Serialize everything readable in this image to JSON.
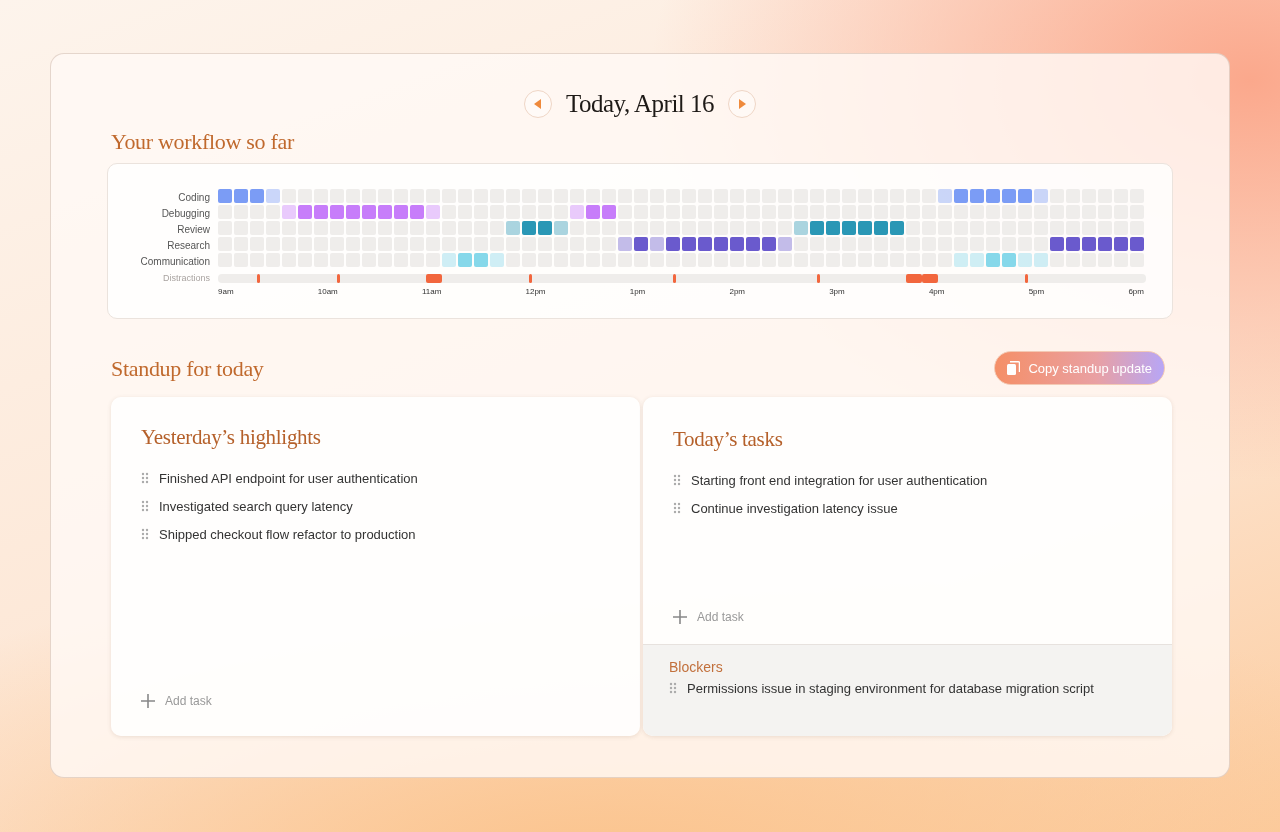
{
  "date_nav": {
    "title": "Today, April 16"
  },
  "workflow": {
    "title": "Your workflow so far",
    "rows": [
      {
        "label": "Coding",
        "color": "#7b9cf5",
        "cells": [
          {
            "kind": "full"
          },
          {
            "kind": "full"
          },
          {
            "kind": "full"
          },
          {
            "kind": "light"
          },
          {
            "kind": "empty"
          },
          {
            "kind": "empty"
          },
          {
            "kind": "empty"
          },
          {
            "kind": "empty"
          },
          {
            "kind": "empty"
          },
          {
            "kind": "empty"
          },
          {
            "kind": "empty"
          },
          {
            "kind": "empty"
          },
          {
            "kind": "empty"
          },
          {
            "kind": "empty"
          },
          {
            "kind": "empty"
          },
          {
            "kind": "empty"
          },
          {
            "kind": "empty"
          },
          {
            "kind": "empty"
          },
          {
            "kind": "empty"
          },
          {
            "kind": "empty"
          },
          {
            "kind": "empty"
          },
          {
            "kind": "empty"
          },
          {
            "kind": "empty"
          },
          {
            "kind": "empty"
          },
          {
            "kind": "empty"
          },
          {
            "kind": "empty"
          },
          {
            "kind": "empty"
          },
          {
            "kind": "empty"
          },
          {
            "kind": "empty"
          },
          {
            "kind": "empty"
          },
          {
            "kind": "empty"
          },
          {
            "kind": "empty"
          },
          {
            "kind": "empty"
          },
          {
            "kind": "empty"
          },
          {
            "kind": "empty"
          },
          {
            "kind": "empty"
          },
          {
            "kind": "empty"
          },
          {
            "kind": "empty"
          },
          {
            "kind": "empty"
          },
          {
            "kind": "empty"
          },
          {
            "kind": "empty"
          },
          {
            "kind": "empty"
          },
          {
            "kind": "empty"
          },
          {
            "kind": "empty"
          },
          {
            "kind": "empty"
          },
          {
            "kind": "light"
          },
          {
            "kind": "full"
          },
          {
            "kind": "full"
          },
          {
            "kind": "full"
          },
          {
            "kind": "full"
          },
          {
            "kind": "full"
          },
          {
            "kind": "light"
          },
          {
            "kind": "empty"
          },
          {
            "kind": "empty"
          },
          {
            "kind": "empty"
          },
          {
            "kind": "empty"
          },
          {
            "kind": "empty"
          },
          {
            "kind": "empty"
          }
        ]
      },
      {
        "label": "Debugging",
        "color": "#c77dfa",
        "cells": [
          {
            "kind": "empty"
          },
          {
            "kind": "empty"
          },
          {
            "kind": "empty"
          },
          {
            "kind": "empty"
          },
          {
            "kind": "light"
          },
          {
            "kind": "full"
          },
          {
            "kind": "full"
          },
          {
            "kind": "full"
          },
          {
            "kind": "full"
          },
          {
            "kind": "full"
          },
          {
            "kind": "full"
          },
          {
            "kind": "full"
          },
          {
            "kind": "full"
          },
          {
            "kind": "light"
          },
          {
            "kind": "empty"
          },
          {
            "kind": "empty"
          },
          {
            "kind": "empty"
          },
          {
            "kind": "empty"
          },
          {
            "kind": "empty"
          },
          {
            "kind": "empty"
          },
          {
            "kind": "empty"
          },
          {
            "kind": "empty"
          },
          {
            "kind": "light"
          },
          {
            "kind": "full"
          },
          {
            "kind": "full"
          },
          {
            "kind": "empty"
          },
          {
            "kind": "empty"
          },
          {
            "kind": "empty"
          },
          {
            "kind": "empty"
          },
          {
            "kind": "empty"
          },
          {
            "kind": "empty"
          },
          {
            "kind": "empty"
          },
          {
            "kind": "empty"
          },
          {
            "kind": "empty"
          },
          {
            "kind": "empty"
          },
          {
            "kind": "empty"
          },
          {
            "kind": "empty"
          },
          {
            "kind": "empty"
          },
          {
            "kind": "empty"
          },
          {
            "kind": "empty"
          },
          {
            "kind": "empty"
          },
          {
            "kind": "empty"
          },
          {
            "kind": "empty"
          },
          {
            "kind": "empty"
          },
          {
            "kind": "empty"
          },
          {
            "kind": "empty"
          },
          {
            "kind": "empty"
          },
          {
            "kind": "empty"
          },
          {
            "kind": "empty"
          },
          {
            "kind": "empty"
          },
          {
            "kind": "empty"
          },
          {
            "kind": "empty"
          },
          {
            "kind": "empty"
          },
          {
            "kind": "empty"
          },
          {
            "kind": "empty"
          },
          {
            "kind": "empty"
          },
          {
            "kind": "empty"
          },
          {
            "kind": "empty"
          }
        ]
      },
      {
        "label": "Review",
        "color": "#2a97b5",
        "cells": [
          {
            "kind": "empty"
          },
          {
            "kind": "empty"
          },
          {
            "kind": "empty"
          },
          {
            "kind": "empty"
          },
          {
            "kind": "empty"
          },
          {
            "kind": "empty"
          },
          {
            "kind": "empty"
          },
          {
            "kind": "empty"
          },
          {
            "kind": "empty"
          },
          {
            "kind": "empty"
          },
          {
            "kind": "empty"
          },
          {
            "kind": "empty"
          },
          {
            "kind": "empty"
          },
          {
            "kind": "empty"
          },
          {
            "kind": "empty"
          },
          {
            "kind": "empty"
          },
          {
            "kind": "empty"
          },
          {
            "kind": "empty"
          },
          {
            "kind": "light"
          },
          {
            "kind": "full"
          },
          {
            "kind": "full"
          },
          {
            "kind": "light"
          },
          {
            "kind": "empty"
          },
          {
            "kind": "empty"
          },
          {
            "kind": "empty"
          },
          {
            "kind": "empty"
          },
          {
            "kind": "empty"
          },
          {
            "kind": "empty"
          },
          {
            "kind": "empty"
          },
          {
            "kind": "empty"
          },
          {
            "kind": "empty"
          },
          {
            "kind": "empty"
          },
          {
            "kind": "empty"
          },
          {
            "kind": "empty"
          },
          {
            "kind": "empty"
          },
          {
            "kind": "empty"
          },
          {
            "kind": "light"
          },
          {
            "kind": "full"
          },
          {
            "kind": "full"
          },
          {
            "kind": "full"
          },
          {
            "kind": "full"
          },
          {
            "kind": "full"
          },
          {
            "kind": "full"
          },
          {
            "kind": "empty"
          },
          {
            "kind": "empty"
          },
          {
            "kind": "empty"
          },
          {
            "kind": "empty"
          },
          {
            "kind": "empty"
          },
          {
            "kind": "empty"
          },
          {
            "kind": "empty"
          },
          {
            "kind": "empty"
          },
          {
            "kind": "empty"
          },
          {
            "kind": "empty"
          },
          {
            "kind": "empty"
          },
          {
            "kind": "empty"
          },
          {
            "kind": "empty"
          },
          {
            "kind": "empty"
          },
          {
            "kind": "empty"
          }
        ]
      },
      {
        "label": "Research",
        "color": "#6a5acd",
        "cells": [
          {
            "kind": "empty"
          },
          {
            "kind": "empty"
          },
          {
            "kind": "empty"
          },
          {
            "kind": "empty"
          },
          {
            "kind": "empty"
          },
          {
            "kind": "empty"
          },
          {
            "kind": "empty"
          },
          {
            "kind": "empty"
          },
          {
            "kind": "empty"
          },
          {
            "kind": "empty"
          },
          {
            "kind": "empty"
          },
          {
            "kind": "empty"
          },
          {
            "kind": "empty"
          },
          {
            "kind": "empty"
          },
          {
            "kind": "empty"
          },
          {
            "kind": "empty"
          },
          {
            "kind": "empty"
          },
          {
            "kind": "empty"
          },
          {
            "kind": "empty"
          },
          {
            "kind": "empty"
          },
          {
            "kind": "empty"
          },
          {
            "kind": "empty"
          },
          {
            "kind": "empty"
          },
          {
            "kind": "empty"
          },
          {
            "kind": "empty"
          },
          {
            "kind": "light"
          },
          {
            "kind": "full"
          },
          {
            "kind": "light"
          },
          {
            "kind": "full"
          },
          {
            "kind": "full"
          },
          {
            "kind": "full"
          },
          {
            "kind": "full"
          },
          {
            "kind": "full"
          },
          {
            "kind": "full"
          },
          {
            "kind": "full"
          },
          {
            "kind": "light"
          },
          {
            "kind": "empty"
          },
          {
            "kind": "empty"
          },
          {
            "kind": "empty"
          },
          {
            "kind": "empty"
          },
          {
            "kind": "empty"
          },
          {
            "kind": "empty"
          },
          {
            "kind": "empty"
          },
          {
            "kind": "empty"
          },
          {
            "kind": "empty"
          },
          {
            "kind": "empty"
          },
          {
            "kind": "empty"
          },
          {
            "kind": "empty"
          },
          {
            "kind": "empty"
          },
          {
            "kind": "empty"
          },
          {
            "kind": "empty"
          },
          {
            "kind": "empty"
          },
          {
            "kind": "full"
          },
          {
            "kind": "full"
          },
          {
            "kind": "full"
          },
          {
            "kind": "full"
          },
          {
            "kind": "full"
          },
          {
            "kind": "full"
          }
        ]
      },
      {
        "label": "Communication",
        "color": "#86d8ea",
        "cells": [
          {
            "kind": "empty"
          },
          {
            "kind": "empty"
          },
          {
            "kind": "empty"
          },
          {
            "kind": "empty"
          },
          {
            "kind": "empty"
          },
          {
            "kind": "empty"
          },
          {
            "kind": "empty"
          },
          {
            "kind": "empty"
          },
          {
            "kind": "empty"
          },
          {
            "kind": "empty"
          },
          {
            "kind": "empty"
          },
          {
            "kind": "empty"
          },
          {
            "kind": "empty"
          },
          {
            "kind": "empty"
          },
          {
            "kind": "light"
          },
          {
            "kind": "full"
          },
          {
            "kind": "full"
          },
          {
            "kind": "light"
          },
          {
            "kind": "empty"
          },
          {
            "kind": "empty"
          },
          {
            "kind": "empty"
          },
          {
            "kind": "empty"
          },
          {
            "kind": "empty"
          },
          {
            "kind": "empty"
          },
          {
            "kind": "empty"
          },
          {
            "kind": "empty"
          },
          {
            "kind": "empty"
          },
          {
            "kind": "empty"
          },
          {
            "kind": "empty"
          },
          {
            "kind": "empty"
          },
          {
            "kind": "empty"
          },
          {
            "kind": "empty"
          },
          {
            "kind": "empty"
          },
          {
            "kind": "empty"
          },
          {
            "kind": "empty"
          },
          {
            "kind": "empty"
          },
          {
            "kind": "empty"
          },
          {
            "kind": "empty"
          },
          {
            "kind": "empty"
          },
          {
            "kind": "empty"
          },
          {
            "kind": "empty"
          },
          {
            "kind": "empty"
          },
          {
            "kind": "empty"
          },
          {
            "kind": "empty"
          },
          {
            "kind": "empty"
          },
          {
            "kind": "empty"
          },
          {
            "kind": "light"
          },
          {
            "kind": "light"
          },
          {
            "kind": "full"
          },
          {
            "kind": "full"
          },
          {
            "kind": "light"
          },
          {
            "kind": "light"
          },
          {
            "kind": "empty"
          },
          {
            "kind": "empty"
          },
          {
            "kind": "empty"
          },
          {
            "kind": "empty"
          },
          {
            "kind": "empty"
          },
          {
            "kind": "empty"
          }
        ]
      }
    ],
    "distractions": {
      "label": "Distractions",
      "slots": [
        {
          "kind": "none"
        },
        {
          "kind": "none"
        },
        {
          "kind": "blip"
        },
        {
          "kind": "none"
        },
        {
          "kind": "none"
        },
        {
          "kind": "none"
        },
        {
          "kind": "none"
        },
        {
          "kind": "blip"
        },
        {
          "kind": "none"
        },
        {
          "kind": "none"
        },
        {
          "kind": "none"
        },
        {
          "kind": "none"
        },
        {
          "kind": "none"
        },
        {
          "kind": "block"
        },
        {
          "kind": "none"
        },
        {
          "kind": "none"
        },
        {
          "kind": "none"
        },
        {
          "kind": "none"
        },
        {
          "kind": "none"
        },
        {
          "kind": "blip"
        },
        {
          "kind": "none"
        },
        {
          "kind": "none"
        },
        {
          "kind": "none"
        },
        {
          "kind": "none"
        },
        {
          "kind": "none"
        },
        {
          "kind": "none"
        },
        {
          "kind": "none"
        },
        {
          "kind": "none"
        },
        {
          "kind": "blip"
        },
        {
          "kind": "none"
        },
        {
          "kind": "none"
        },
        {
          "kind": "none"
        },
        {
          "kind": "none"
        },
        {
          "kind": "none"
        },
        {
          "kind": "none"
        },
        {
          "kind": "none"
        },
        {
          "kind": "none"
        },
        {
          "kind": "blip"
        },
        {
          "kind": "none"
        },
        {
          "kind": "none"
        },
        {
          "kind": "none"
        },
        {
          "kind": "none"
        },
        {
          "kind": "none"
        },
        {
          "kind": "block"
        },
        {
          "kind": "block"
        },
        {
          "kind": "none"
        },
        {
          "kind": "none"
        },
        {
          "kind": "none"
        },
        {
          "kind": "none"
        },
        {
          "kind": "none"
        },
        {
          "kind": "blip"
        },
        {
          "kind": "none"
        },
        {
          "kind": "none"
        },
        {
          "kind": "none"
        },
        {
          "kind": "none"
        },
        {
          "kind": "none"
        },
        {
          "kind": "none"
        },
        {
          "kind": "none"
        }
      ]
    },
    "time_labels": [
      "9am",
      "10am",
      "11am",
      "12pm",
      "1pm",
      "2pm",
      "3pm",
      "4pm",
      "5pm",
      "6pm"
    ]
  },
  "standup": {
    "title": "Standup for today",
    "copy_button": "Copy standup update",
    "yesterday": {
      "title": "Yesterday’s highlights",
      "items": [
        "Finished API endpoint for user authentication",
        "Investigated search query latency",
        "Shipped checkout flow refactor to production"
      ],
      "add_label": "Add task"
    },
    "today": {
      "title": "Today’s tasks",
      "items": [
        "Starting front end integration for user authentication",
        "Continue investigation latency issue"
      ],
      "add_label": "Add task"
    },
    "blockers": {
      "title": "Blockers",
      "items": [
        "Permissions issue in staging environment for database migration script"
      ]
    }
  }
}
